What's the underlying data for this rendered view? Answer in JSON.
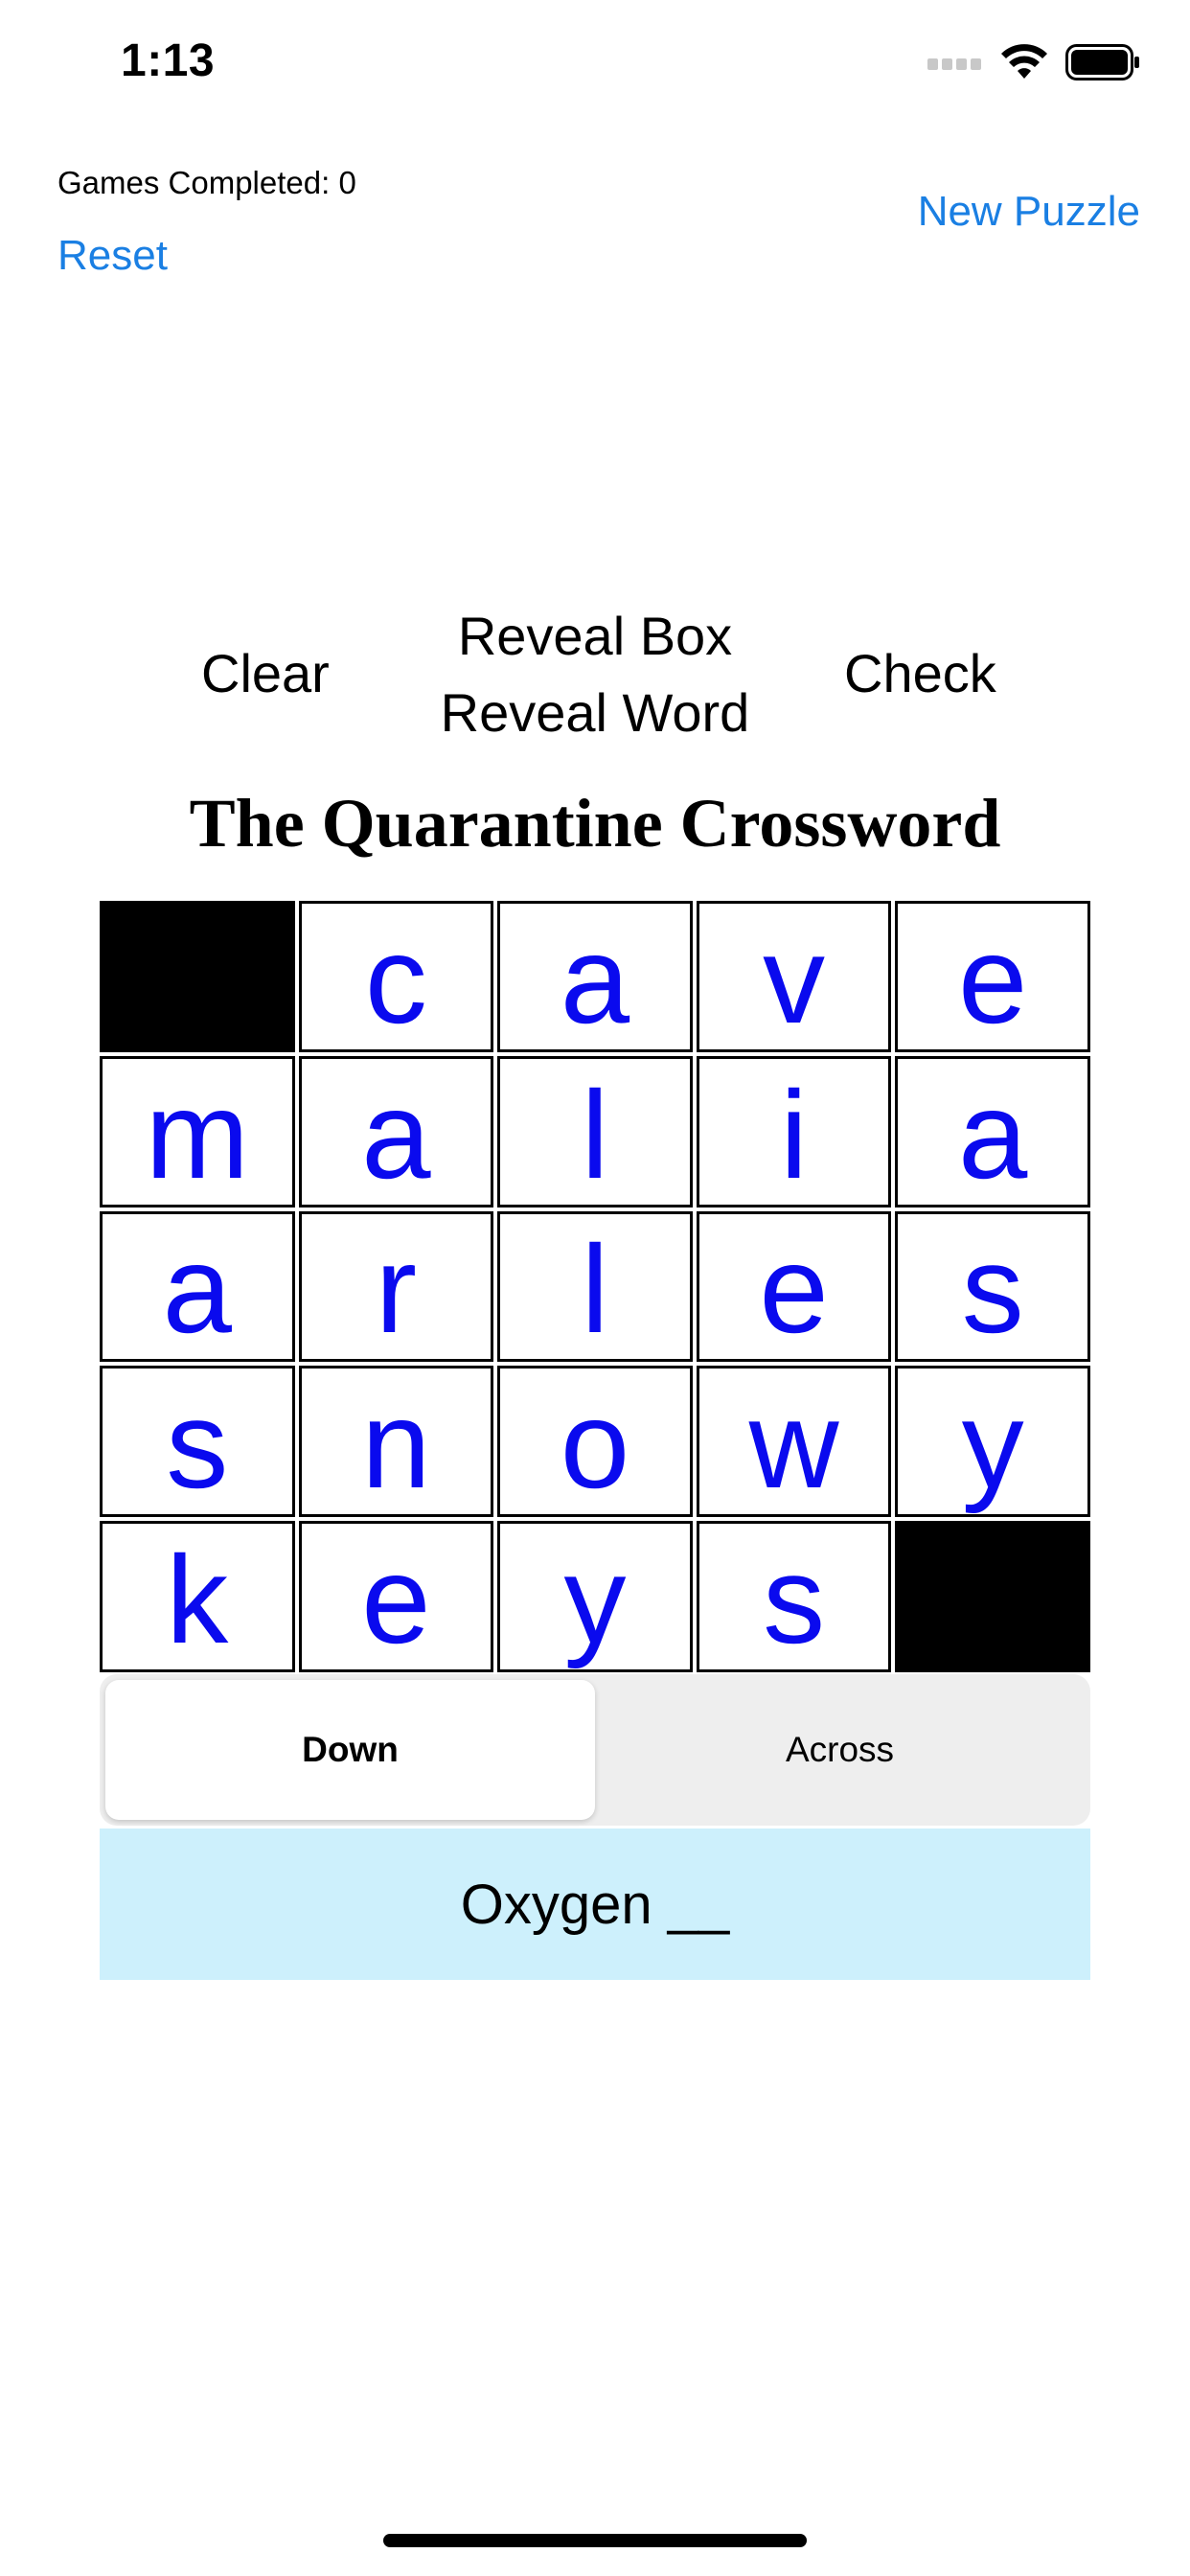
{
  "status_bar": {
    "time": "1:13",
    "icons": [
      "cellular-signal-icon",
      "wifi-icon",
      "battery-icon"
    ]
  },
  "header": {
    "games_completed": "Games Completed: 0",
    "reset_label": "Reset",
    "new_puzzle_label": "New Puzzle"
  },
  "actions": {
    "clear_label": "Clear",
    "reveal_box_label": "Reveal Box",
    "reveal_word_label": "Reveal Word",
    "check_label": "Check"
  },
  "title": "The Quarantine Crossword",
  "grid": {
    "rows": [
      [
        null,
        "c",
        "a",
        "v",
        "e"
      ],
      [
        "m",
        "a",
        "l",
        "i",
        "a"
      ],
      [
        "a",
        "r",
        "l",
        "e",
        "s"
      ],
      [
        "s",
        "n",
        "o",
        "w",
        "y"
      ],
      [
        "k",
        "e",
        "y",
        "s",
        null
      ]
    ],
    "letter_color": "#0a0aee"
  },
  "direction_toggle": {
    "down_label": "Down",
    "across_label": "Across",
    "selected": "Down"
  },
  "clue": {
    "text": "Oxygen __",
    "highlight_color": "#cdf0fc"
  },
  "colors": {
    "accent": "#1a7fe3"
  }
}
